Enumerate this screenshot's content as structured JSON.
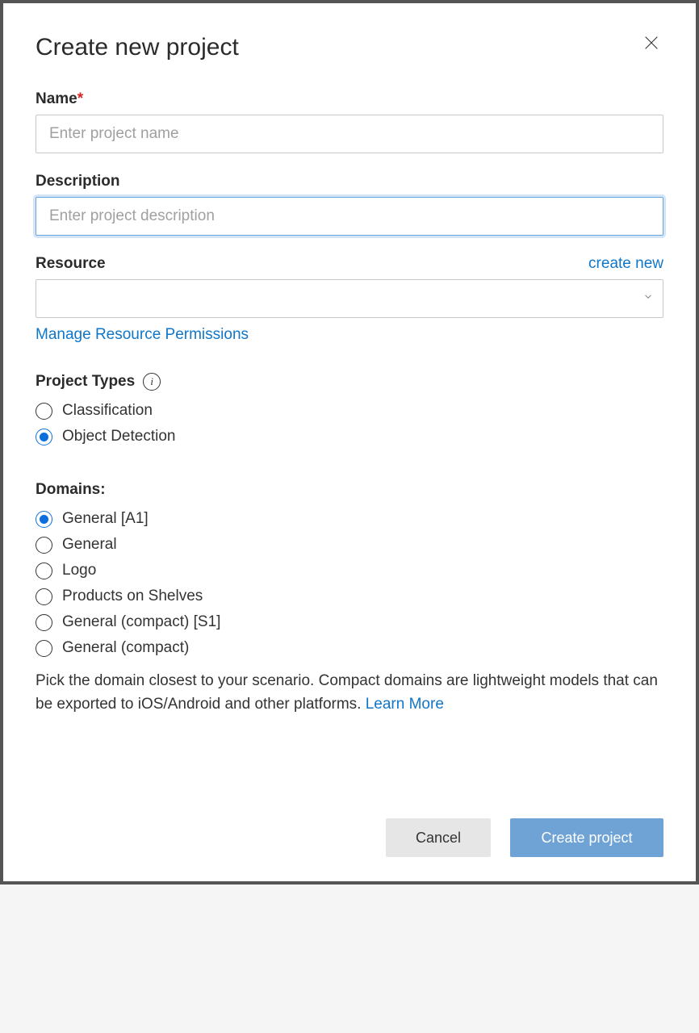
{
  "dialog": {
    "title": "Create new project",
    "close_aria": "Close"
  },
  "form": {
    "name": {
      "label": "Name",
      "required_mark": "*",
      "placeholder": "Enter project name",
      "value": ""
    },
    "description": {
      "label": "Description",
      "placeholder": "Enter project description",
      "value": ""
    },
    "resource": {
      "label": "Resource",
      "create_new_link": "create new",
      "selected": "",
      "manage_permissions_link": "Manage Resource Permissions"
    },
    "project_types": {
      "label": "Project Types",
      "info_aria": "Project types info",
      "options": [
        {
          "label": "Classification",
          "selected": false
        },
        {
          "label": "Object Detection",
          "selected": true
        }
      ]
    },
    "domains": {
      "label": "Domains:",
      "options": [
        {
          "label": "General [A1]",
          "selected": true
        },
        {
          "label": "General",
          "selected": false
        },
        {
          "label": "Logo",
          "selected": false
        },
        {
          "label": "Products on Shelves",
          "selected": false
        },
        {
          "label": "General (compact) [S1]",
          "selected": false
        },
        {
          "label": "General (compact)",
          "selected": false
        }
      ],
      "description_text": "Pick the domain closest to your scenario. Compact domains are lightweight models that can be exported to iOS/Android and other platforms. ",
      "learn_more_link": "Learn More"
    }
  },
  "footer": {
    "cancel_label": "Cancel",
    "create_label": "Create project"
  }
}
